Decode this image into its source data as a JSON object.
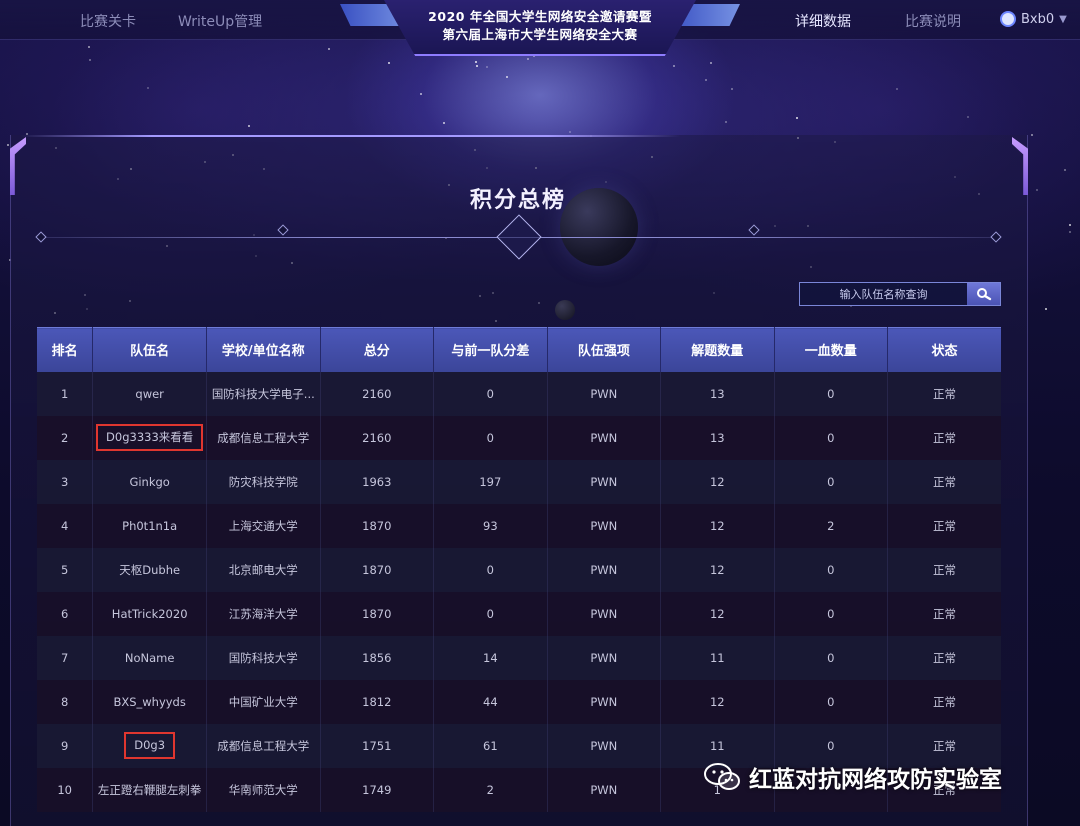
{
  "nav": {
    "left_items": [
      "比赛关卡",
      "WriteUp管理"
    ],
    "right_items": [
      "详细数据",
      "比赛说明"
    ],
    "active": "详细数据",
    "title_line1": "2020 年全国大学生网络安全邀请赛暨",
    "title_line2": "第六届上海市大学生网络安全大赛",
    "user": "Bxb0"
  },
  "board": {
    "title": "积分总榜",
    "search_placeholder": "输入队伍名称查询"
  },
  "table": {
    "columns": [
      "排名",
      "队伍名",
      "学校/单位名称",
      "总分",
      "与前一队分差",
      "队伍强项",
      "解题数量",
      "一血数量",
      "状态"
    ],
    "rows": [
      [
        "1",
        "qwer",
        "国防科技大学电子...",
        "2160",
        "0",
        "PWN",
        "13",
        "0",
        "正常"
      ],
      [
        "2",
        "D0g3333来看看",
        "成都信息工程大学",
        "2160",
        "0",
        "PWN",
        "13",
        "0",
        "正常"
      ],
      [
        "3",
        "Ginkgo",
        "防灾科技学院",
        "1963",
        "197",
        "PWN",
        "12",
        "0",
        "正常"
      ],
      [
        "4",
        "Ph0t1n1a",
        "上海交通大学",
        "1870",
        "93",
        "PWN",
        "12",
        "2",
        "正常"
      ],
      [
        "5",
        "天枢Dubhe",
        "北京邮电大学",
        "1870",
        "0",
        "PWN",
        "12",
        "0",
        "正常"
      ],
      [
        "6",
        "HatTrick2020",
        "江苏海洋大学",
        "1870",
        "0",
        "PWN",
        "12",
        "0",
        "正常"
      ],
      [
        "7",
        "NoName",
        "国防科技大学",
        "1856",
        "14",
        "PWN",
        "11",
        "0",
        "正常"
      ],
      [
        "8",
        "BXS_whyyds",
        "中国矿业大学",
        "1812",
        "44",
        "PWN",
        "12",
        "0",
        "正常"
      ],
      [
        "9",
        "D0g3",
        "成都信息工程大学",
        "1751",
        "61",
        "PWN",
        "11",
        "0",
        "正常"
      ],
      [
        "10",
        "左正蹬右鞭腿左刺拳",
        "华南师范大学",
        "1749",
        "2",
        "PWN",
        "1",
        "",
        "正常"
      ]
    ],
    "highlighted_rows": [
      1,
      8
    ],
    "highlight_color": "#e0362f"
  },
  "watermark": {
    "text": "红蓝对抗网络攻防实验室",
    "icon": "wechat-icon"
  }
}
